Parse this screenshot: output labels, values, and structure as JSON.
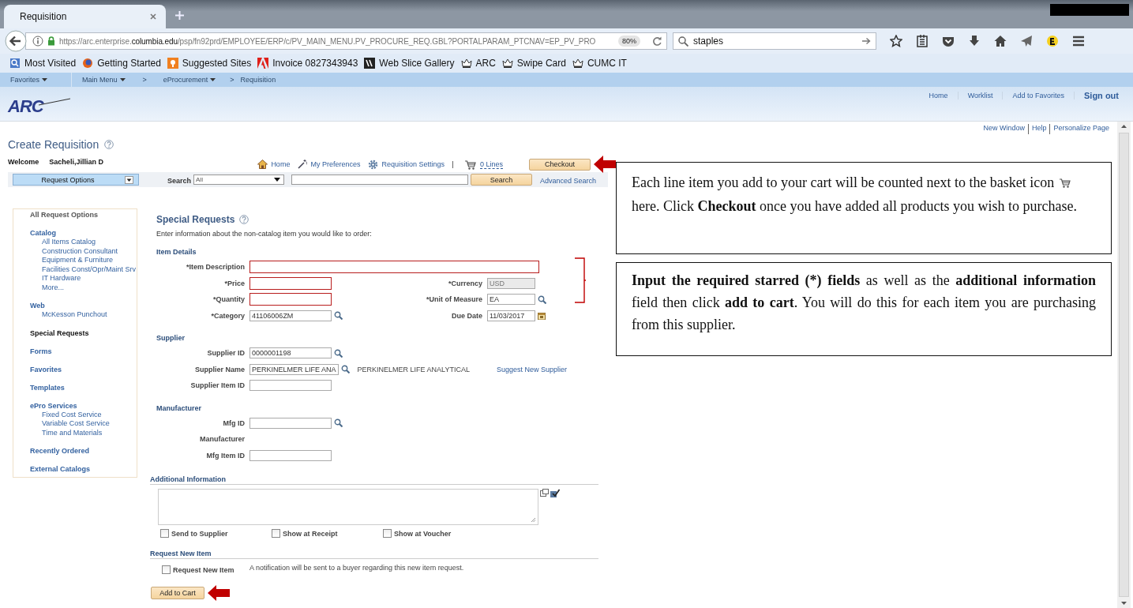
{
  "browser": {
    "tab_title": "Requisition",
    "url": {
      "prefix": "https://arc.enterprise.",
      "host": "columbia.edu",
      "path": "/psp/fn92prd/EMPLOYEE/ERP/c/PV_MAIN_MENU.PV_PROCURE_REQ.GBL?PORTALPARAM_PTCNAV=EP_PV_PRO"
    },
    "zoom": "80%",
    "search": "staples",
    "bookmarks": [
      {
        "label": "Most Visited",
        "kind": "page"
      },
      {
        "label": "Getting Started",
        "kind": "globe"
      },
      {
        "label": "Suggested Sites",
        "kind": "bulb"
      },
      {
        "label": "Invoice 0827343943",
        "kind": "pdf"
      },
      {
        "label": "Web Slice Gallery",
        "kind": "slice"
      },
      {
        "label": "ARC",
        "kind": "crown"
      },
      {
        "label": "Swipe Card",
        "kind": "crown"
      },
      {
        "label": "CUMC IT",
        "kind": "crown"
      }
    ]
  },
  "nav": [
    {
      "label": "Favorites",
      "kind": "menu"
    },
    {
      "label": "Main Menu",
      "kind": "menu"
    },
    {
      "label": ">",
      "kind": "sep"
    },
    {
      "label": "eProcurement",
      "kind": "menu"
    },
    {
      "label": ">",
      "kind": "sep"
    },
    {
      "label": "Requisition",
      "kind": "page"
    }
  ],
  "header": {
    "logo": "ARC",
    "links": [
      "Home",
      "Worklist",
      "Add to Favorites",
      "Sign out"
    ]
  },
  "page_links": [
    "New Window",
    "Help",
    "Personalize Page"
  ],
  "title": "Create Requisition",
  "welcome": {
    "label": "Welcome",
    "user": "Sacheli,Jillian D"
  },
  "toolbar": {
    "links": [
      {
        "label": "Home",
        "kind": "home"
      },
      {
        "label": "My Preferences",
        "kind": "wand"
      },
      {
        "label": "Requisition Settings",
        "kind": "gear"
      }
    ],
    "cart_lines": "0 Lines",
    "checkout": "Checkout"
  },
  "search_bar": {
    "request_options": "Request Options",
    "label": "Search",
    "scope": "All",
    "button": "Search",
    "advanced": "Advanced Search"
  },
  "sidebar": [
    {
      "label": "All Request Options",
      "kind": "title",
      "selected": false
    },
    {
      "label": "Catalog",
      "kind": "group",
      "selected": false,
      "children": [
        {
          "label": "All Items Catalog",
          "selected": false
        },
        {
          "label": "Construction Consultant",
          "selected": false
        },
        {
          "label": "Equipment & Furniture",
          "selected": false
        },
        {
          "label": "Facilities Const/Opr/Maint Srv",
          "selected": false
        },
        {
          "label": "IT Hardware",
          "selected": false
        },
        {
          "label": "More...",
          "selected": false
        }
      ]
    },
    {
      "label": "Web",
      "kind": "group",
      "selected": false,
      "children": [
        {
          "label": "McKesson Punchout",
          "selected": false
        }
      ]
    },
    {
      "label": "Special Requests",
      "kind": "group",
      "selected": true
    },
    {
      "label": "Forms",
      "kind": "group",
      "selected": false
    },
    {
      "label": "Favorites",
      "kind": "group",
      "selected": false
    },
    {
      "label": "Templates",
      "kind": "group",
      "selected": false
    },
    {
      "label": "ePro Services",
      "kind": "group",
      "selected": false,
      "children": [
        {
          "label": "Fixed Cost Service",
          "selected": false
        },
        {
          "label": "Variable Cost Service",
          "selected": false
        },
        {
          "label": "Time and Materials",
          "selected": false
        }
      ]
    },
    {
      "label": "Recently Ordered",
      "kind": "group",
      "selected": false
    },
    {
      "label": "External Catalogs",
      "kind": "group",
      "selected": false
    }
  ],
  "form": {
    "title": "Special Requests",
    "intro": "Enter information about the non-catalog item you would like to order:",
    "sections": [
      {
        "heading": "Item Details",
        "rows": [
          {
            "left": {
              "label": "*Item Description",
              "kind": "input",
              "highlighted": true,
              "long": true
            }
          },
          {
            "left": {
              "label": "*Price",
              "kind": "input",
              "highlighted": true
            },
            "right": {
              "label": "*Currency",
              "kind": "input",
              "value": "USD",
              "disabled": true
            }
          },
          {
            "left": {
              "label": "*Quantity",
              "kind": "input",
              "highlighted": true
            },
            "right": {
              "label": "*Unit of Measure",
              "kind": "input",
              "value": "EA",
              "lookup": true
            }
          },
          {
            "left": {
              "label": "*Category",
              "kind": "input",
              "value": "41106006ZM",
              "lookup": true
            },
            "right": {
              "label": "Due Date",
              "kind": "input",
              "value": "11/03/2017",
              "calendar": true
            }
          }
        ]
      },
      {
        "heading": "Supplier",
        "rows": [
          {
            "left": {
              "label": "Supplier ID",
              "kind": "input",
              "value": "0000001198",
              "lookup": true
            }
          },
          {
            "left": {
              "label": "Supplier Name",
              "kind": "input",
              "value": "PERKINELMER LIFE ANA",
              "lookup": true,
              "note": "PERKINELMER LIFE ANALYTICAL",
              "link": "Suggest New Supplier"
            }
          },
          {
            "left": {
              "label": "Supplier Item ID",
              "kind": "input"
            }
          }
        ]
      },
      {
        "heading": "Manufacturer",
        "rows": [
          {
            "left": {
              "label": "Mfg ID",
              "kind": "input",
              "lookup": true
            }
          },
          {
            "left": {
              "label": "Manufacturer",
              "kind": "static"
            }
          },
          {
            "left": {
              "label": "Mfg Item ID",
              "kind": "input"
            }
          }
        ]
      }
    ],
    "additional": {
      "heading": "Additional Information",
      "options": [
        {
          "label": "Send to Supplier",
          "checked": false
        },
        {
          "label": "Show at Receipt",
          "checked": false
        },
        {
          "label": "Show at Voucher",
          "checked": false
        }
      ]
    },
    "new_item": {
      "heading": "Request New Item",
      "option": {
        "label": "Request New Item",
        "checked": false
      },
      "note": "A notification will be sent to a buyer regarding this new item request."
    },
    "add_to_cart": "Add to Cart"
  },
  "callouts": [
    {
      "parts": [
        "Each line item you add to your cart will be counted next to the basket icon",
        "here. Click **Checkout** once you have added all products you wish to purchase."
      ]
    },
    {
      "parts": [
        "**Input the required starred (*) fields** as well as the **additional information** field then click **add to cart**. You will do this for each item you are purchasing from this supplier."
      ]
    }
  ]
}
